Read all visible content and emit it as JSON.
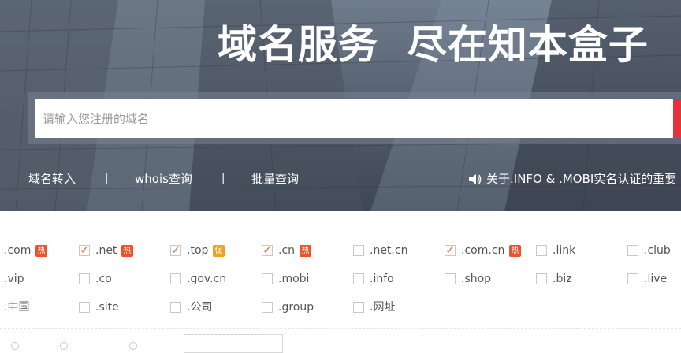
{
  "hero": {
    "title": "域名服务  尽在知本盒子"
  },
  "search": {
    "placeholder": "请输入您注册的域名",
    "value": ""
  },
  "quick_links": {
    "transfer": "域名转入",
    "separator": "|",
    "whois": "whois查询",
    "batch": "批量查询",
    "notice": "关于.INFO & .MOBI实名认证的重要"
  },
  "tlds": [
    {
      "label": ".com",
      "checked": true,
      "badge": "热"
    },
    {
      "label": ".net",
      "checked": true,
      "badge": "热"
    },
    {
      "label": ".top",
      "checked": true,
      "badge": "促"
    },
    {
      "label": ".cn",
      "checked": true,
      "badge": "热"
    },
    {
      "label": ".net.cn",
      "checked": false,
      "badge": ""
    },
    {
      "label": ".com.cn",
      "checked": true,
      "badge": "热"
    },
    {
      "label": ".link",
      "checked": false,
      "badge": ""
    },
    {
      "label": ".club",
      "checked": false,
      "badge": ""
    },
    {
      "label": ".vip",
      "checked": false,
      "badge": ""
    },
    {
      "label": ".co",
      "checked": false,
      "badge": ""
    },
    {
      "label": ".gov.cn",
      "checked": false,
      "badge": ""
    },
    {
      "label": ".mobi",
      "checked": false,
      "badge": ""
    },
    {
      "label": ".info",
      "checked": false,
      "badge": ""
    },
    {
      "label": ".shop",
      "checked": false,
      "badge": ""
    },
    {
      "label": ".biz",
      "checked": false,
      "badge": ""
    },
    {
      "label": ".live",
      "checked": false,
      "badge": ""
    },
    {
      "label": ".中国",
      "checked": false,
      "badge": ""
    },
    {
      "label": ".site",
      "checked": false,
      "badge": ""
    },
    {
      "label": ".公司",
      "checked": false,
      "badge": ""
    },
    {
      "label": ".group",
      "checked": false,
      "badge": ""
    },
    {
      "label": ".网址",
      "checked": false,
      "badge": ""
    }
  ],
  "colors": {
    "accent_red": "#e5323b",
    "badge_hot": "#e8552d",
    "badge_promo": "#f0a020",
    "check_orange": "#e86a2a"
  },
  "icons": {
    "notice": "speaker-icon",
    "checkmark": "checkmark-icon"
  }
}
